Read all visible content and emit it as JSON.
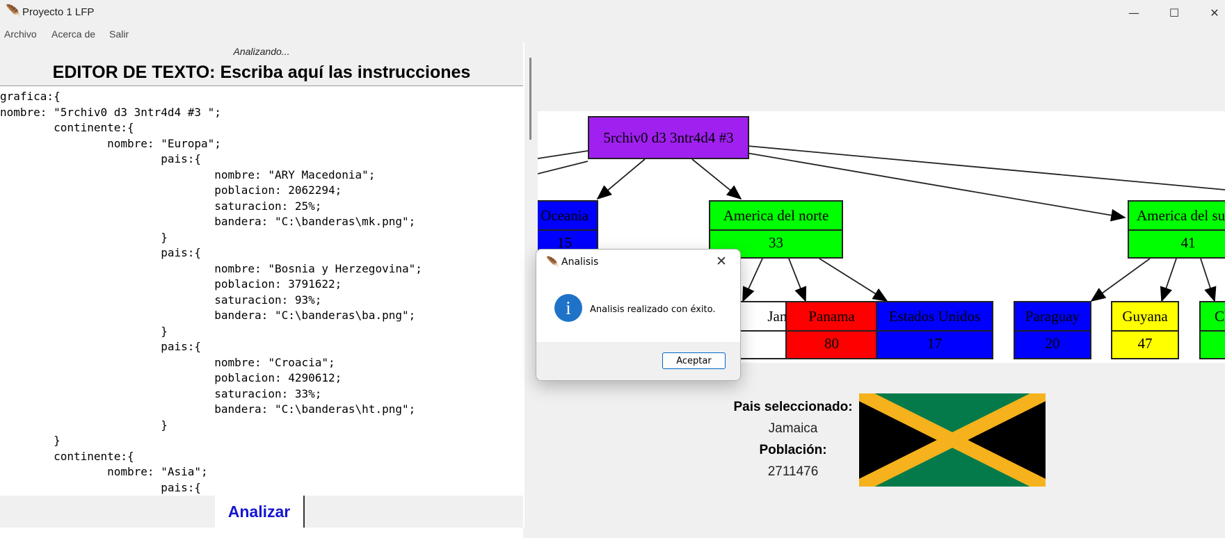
{
  "window": {
    "title": "Proyecto 1 LFP",
    "app_icon": "feather-icon",
    "minimize": "—",
    "maximize": "☐",
    "close": "✕"
  },
  "menu": {
    "items": [
      "Archivo",
      "Acerca de",
      "Salir"
    ]
  },
  "editor": {
    "status": "Analizando...",
    "heading": "EDITOR DE TEXTO: Escriba aquí las instrucciones",
    "content": "grafica:{\nnombre: \"5rchiv0 d3 3ntr4d4 #3 \";\n\tcontinente:{\n\t\tnombre: \"Europa\";\n\t\t\tpais:{\n\t\t\t\tnombre: \"ARY Macedonia\";\n\t\t\t\tpoblacion: 2062294;\n\t\t\t\tsaturacion: 25%;\n\t\t\t\tbandera: \"C:\\banderas\\mk.png\";\n\t\t\t}\n\t\t\tpais:{\n\t\t\t\tnombre: \"Bosnia y Herzegovina\";\n\t\t\t\tpoblacion: 3791622;\n\t\t\t\tsaturacion: 93%;\n\t\t\t\tbandera: \"C:\\banderas\\ba.png\";\n\t\t\t}\n\t\t\tpais:{\n\t\t\t\tnombre: \"Croacia\";\n\t\t\t\tpoblacion: 4290612;\n\t\t\t\tsaturacion: 33%;\n\t\t\t\tbandera: \"C:\\banderas\\ht.png\";\n\t\t\t}\n\t}\n\tcontinente:{\n\t\tnombre: \"Asia\";\n\t\t\tpais:{",
    "analyze_button": "Analizar"
  },
  "graph": {
    "root": {
      "label": "5rchiv0 d3 3ntr4d4 #3",
      "color": "#a020f0"
    },
    "continents": [
      {
        "id": "oceania",
        "label": "Oceania",
        "value": "15",
        "color": "#0000ff"
      },
      {
        "id": "norte",
        "label": "America del norte",
        "value": "33",
        "color": "#00ff00"
      },
      {
        "id": "sur",
        "label": "America del sur",
        "value": "41",
        "color": "#00ff00"
      }
    ],
    "countries": [
      {
        "id": "jamaica",
        "label": "Jamaica",
        "value": "",
        "color": "#ffffff"
      },
      {
        "id": "panama",
        "label": "Panama",
        "value": "80",
        "color": "#ff0000"
      },
      {
        "id": "eeuu",
        "label": "Estados Unidos",
        "value": "17",
        "color": "#0000ff"
      },
      {
        "id": "paraguay",
        "label": "Paraguay",
        "value": "20",
        "color": "#0000ff"
      },
      {
        "id": "guyana",
        "label": "Guyana",
        "value": "47",
        "color": "#ffff00"
      },
      {
        "id": "chile",
        "label": "Chile",
        "value": "",
        "color": "#00ff00"
      }
    ]
  },
  "selection": {
    "country_label": "Pais seleccionado:",
    "country": "Jamaica",
    "population_label": "Población:",
    "population": "2711476",
    "flag_colors": {
      "green": "#047a4a",
      "gold": "#f5b21c",
      "black": "#000000"
    }
  },
  "dialog": {
    "title": "Analisis",
    "message": "Analisis realizado con éxito.",
    "button": "Aceptar",
    "icon": "info-icon",
    "close": "✕"
  }
}
